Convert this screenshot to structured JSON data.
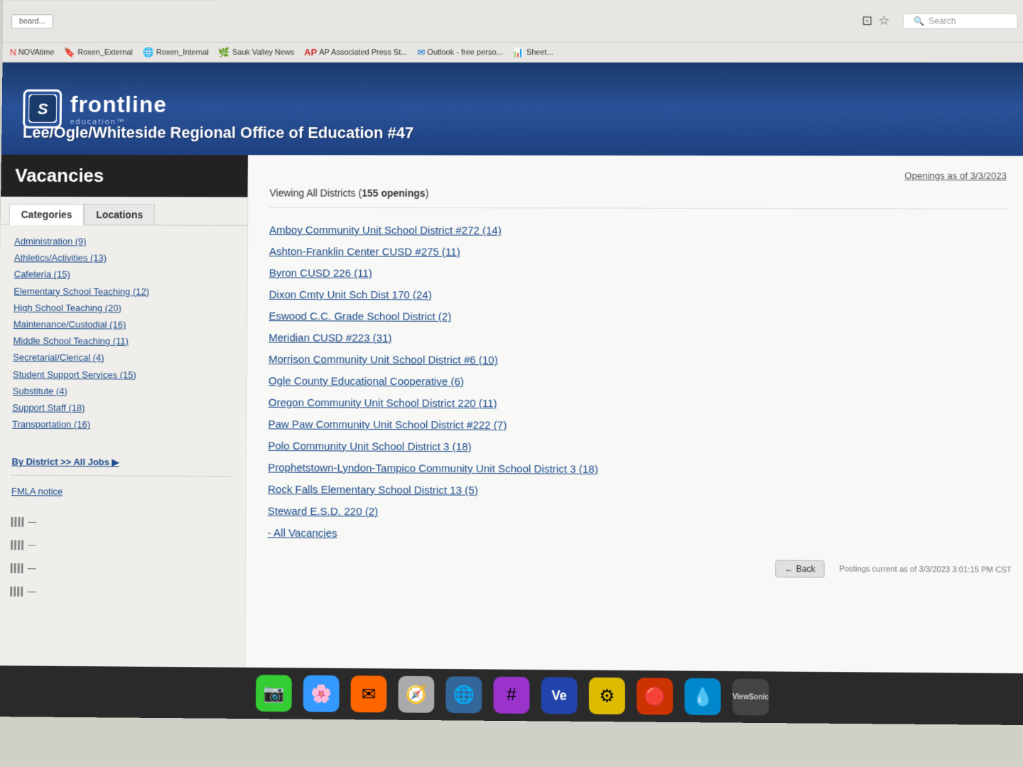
{
  "browser": {
    "bookmarks": [
      {
        "label": "NOVAtime",
        "color": "#e04040"
      },
      {
        "label": "Roxen_External",
        "color": "#e05020"
      },
      {
        "label": "Roxen_Internal",
        "color": "#4444cc"
      },
      {
        "label": "Sauk Valley News",
        "color": "#228822"
      },
      {
        "label": "AP Associated Press St...",
        "color": "#cc2222"
      },
      {
        "label": "Outlook - free perso...",
        "color": "#0066cc"
      },
      {
        "label": "Sheet...",
        "color": "#22aa44"
      }
    ],
    "search_placeholder": "Search"
  },
  "header": {
    "logo_letter": "S",
    "brand_name": "frontline",
    "brand_sub": "education™",
    "org_name": "Lee/Ogle/Whiteside Regional Office of Education #47"
  },
  "sidebar": {
    "vacancies_title": "Vacancies",
    "tab_categories": "Categories",
    "tab_locations": "Locations",
    "categories": [
      "Administration (9)",
      "Athletics/Activities (13)",
      "Cafeteria (15)",
      "Elementary School Teaching (12)",
      "High School Teaching (20)",
      "Maintenance/Custodial (16)",
      "Middle School Teaching (11)",
      "Secretarial/Clerical (4)",
      "Student Support Services (15)",
      "Substitute (4)",
      "Support Staff (18)",
      "Transportation (16)"
    ],
    "by_district_label": "By District >> All Jobs ▶",
    "fmla_label": "FMLA notice"
  },
  "main": {
    "openings_date": "Openings as of 3/3/2023",
    "viewing_text": "Viewing All Districts (",
    "openings_count": "155 openings",
    "viewing_close": ")",
    "districts": [
      "Amboy Community Unit School District #272 (14)",
      "Ashton-Franklin Center CUSD #275 (11)",
      "Byron CUSD 226 (11)",
      "Dixon Cmty Unit Sch Dist 170 (24)",
      "Eswood C.C. Grade School District (2)",
      "Meridian CUSD #223 (31)",
      "Morrison Community Unit School District #6 (10)",
      "Ogle County Educational Cooperative (6)",
      "Oregon Community Unit School District 220 (11)",
      "Paw Paw Community Unit School District #222 (7)",
      "Polo Community Unit School District 3 (18)",
      "Prophetstown-Lyndon-Tampico Community Unit School District 3 (18)",
      "Rock Falls Elementary School District 13 (5)",
      "Steward E.S.D. 220 (2)",
      "- All Vacancies"
    ]
  },
  "footer": {
    "postings_current": "Postings current as of 3/3/2023 3:01:15 PM CST",
    "back_label": "← Back"
  }
}
